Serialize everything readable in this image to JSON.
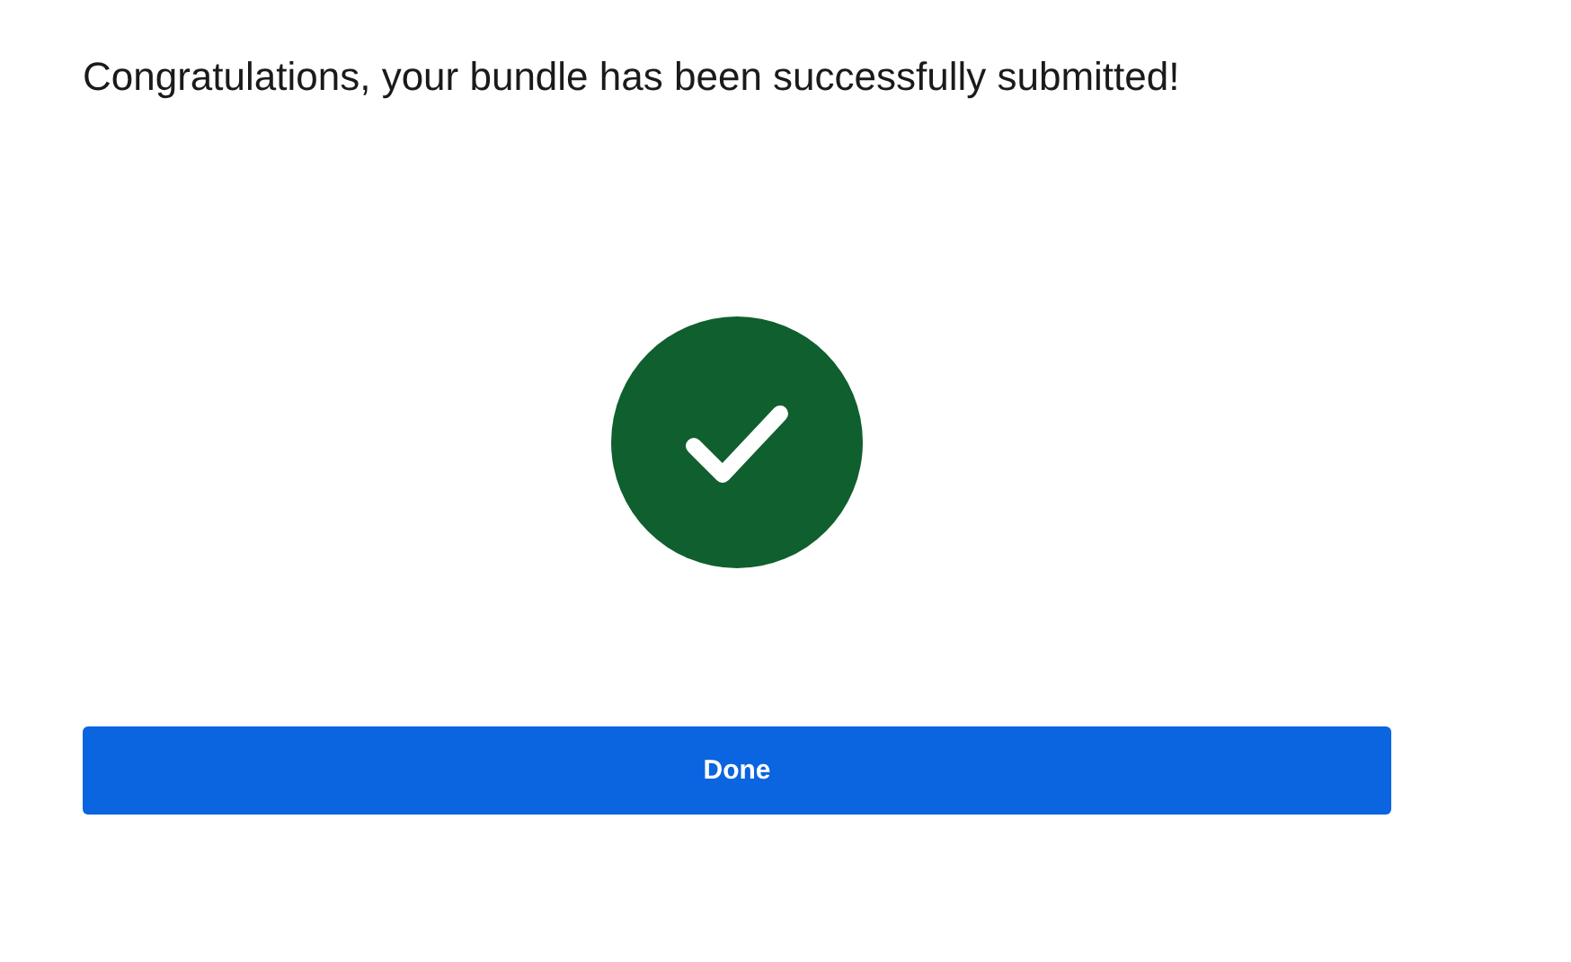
{
  "message": "Congratulations, your bundle has been successfully submitted!",
  "status": {
    "kind": "success"
  },
  "button": {
    "label": "Done"
  }
}
